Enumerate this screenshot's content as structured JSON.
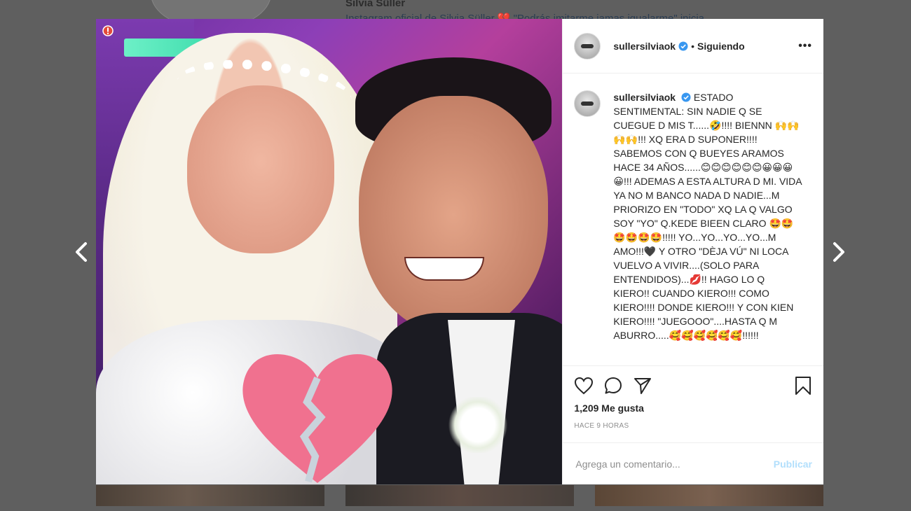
{
  "background": {
    "profile_name": "Silvia Süller",
    "caption_preview": "Instagram oficial de Silvia Süller 💔 \"Podrás imitarme jamas igualarme\" inicia"
  },
  "nav": {
    "prev_icon": "chevron-left-icon",
    "next_icon": "chevron-right-icon"
  },
  "post": {
    "username": "sullersilviaok",
    "separator": "•",
    "follow_status": "Siguiendo",
    "more_label": "•••",
    "caption_username": "sullersilviaok",
    "caption": "ESTADO SENTIMENTAL: SIN NADIE Q SE CUEGUE D MIS T......🤣!!!! BIENNN 🙌🙌🙌🙌!!! XQ ERA D SUPONER!!!! SABEMOS CON Q BUEYES ARAMOS HACE 34 AÑOS......😊😊😊😊😊😊😀😀😀😀!!! ADEMAS A ESTA ALTURA D MI. VIDA YA NO M BANCO NADA D NADIE...M PRIORIZO EN \"TODO\" XQ LA Q VALGO SOY \"YO\" Q.KEDE BIEEN CLARO 🤩🤩🤩🤩🤩🤩!!!!! YO...YO...YO...YO...M AMO!!!🖤 Y OTRO \"DÈJA VÚ\" NI LOCA VUELVO A VIVIR....(SOLO PARA ENTENDIDOS)...💋!! HAGO LO Q KIERO!! CUANDO KIERO!!! COMO KIERO!!!! DONDE KIERO!!! Y CON KIEN KIERO!!!! \"JUEGOOO\"....HASTA Q M ABURRO.....🥰🥰🥰🥰🥰🥰!!!!!!",
    "likes": "1,209 Me gusta",
    "time_ago": "HACE 9 HORAS",
    "comment_placeholder": "Agrega un comentario...",
    "publish_label": "Publicar",
    "colors": {
      "heart": "#f0718f",
      "publish": "#b2dffc",
      "verified": "#3897f0"
    }
  }
}
